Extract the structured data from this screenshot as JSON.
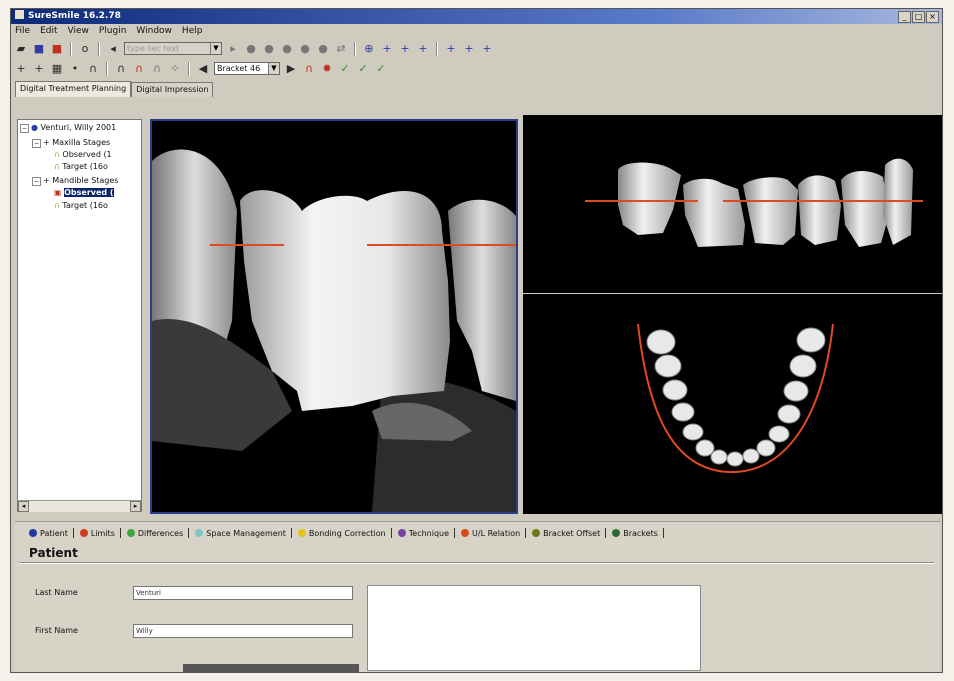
{
  "app": {
    "title": "SureSmile 16.2.78",
    "window_buttons": [
      "_",
      "□",
      "×"
    ]
  },
  "menu": [
    "File",
    "Edit",
    "View",
    "Plugin",
    "Window",
    "Help"
  ],
  "toolbar": {
    "type_combo_placeholder": "type sec text",
    "bracket_combo_value": "Bracket 46"
  },
  "tabs": [
    "Digital Treatment Planning",
    "Digital Impression"
  ],
  "tree": {
    "root": "Venturi, Willy 2001",
    "maxilla": "Maxilla Stages",
    "maxilla_observed": "Observed (1",
    "maxilla_target": "Target (16o",
    "mandible": "Mandible Stages",
    "mandible_observed": "Observed (",
    "mandible_target": "Target (16o"
  },
  "bottom_tabs": [
    {
      "label": "Patient",
      "color": "#1f3a9c"
    },
    {
      "label": "Limits",
      "color": "#d23a1e"
    },
    {
      "label": "Differences",
      "color": "#3fa83c"
    },
    {
      "label": "Space Management",
      "color": "#7fc7c2"
    },
    {
      "label": "Bonding Correction",
      "color": "#e8c21a"
    },
    {
      "label": "Technique",
      "color": "#7a3ea8"
    },
    {
      "label": "U/L Relation",
      "color": "#d84a1c"
    },
    {
      "label": "Bracket Offset",
      "color": "#6a7a1e"
    },
    {
      "label": "Brackets",
      "color": "#2e6a3a"
    }
  ],
  "patient": {
    "section_title": "Patient",
    "last_name_label": "Last Name",
    "last_name_value": "Venturi",
    "first_name_label": "First Name",
    "first_name_value": "Willy"
  },
  "colors": {
    "accent_line": "#e04a20",
    "viewport_border": "#2a3d8c"
  }
}
